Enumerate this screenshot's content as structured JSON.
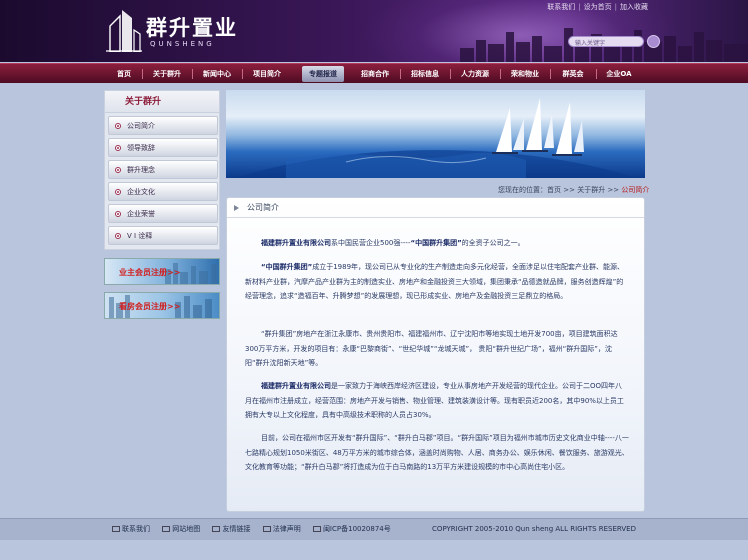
{
  "header": {
    "logo_cn": "群升置业",
    "logo_en": "QUNSHENG",
    "top_links": [
      "联系我们",
      "设为首页",
      "加入收藏"
    ],
    "search_placeholder": "输入关键字"
  },
  "nav": [
    "首页",
    "关于群升",
    "新闻中心",
    "项目简介",
    "专题报道",
    "招商合作",
    "招标信息",
    "人力资源",
    "荣和物业",
    "群英会",
    "企业OA"
  ],
  "sidebar": {
    "title": "关于群升",
    "items": [
      "公司简介",
      "领导致辞",
      "群升理念",
      "企业文化",
      "企业荣誉",
      "V I 诠释"
    ],
    "banners": [
      "业主会员注册>>",
      "看房会员注册>>"
    ]
  },
  "breadcrumb": {
    "prefix": "您现在的位置：",
    "home": "首页",
    "sep": ">>",
    "parent": "关于群升",
    "current": "公司简介"
  },
  "content": {
    "title": "公司简介",
    "p1_a": "福建群升置业有限公司",
    "p1_b": "系中国民营企业500强----",
    "p1_c": "“中国群升集团”",
    "p1_d": "的全资子公司之一。",
    "p2_a": "“中国群升集团”",
    "p2_b": "成立于1989年，现公司已从专业化的生产制造走向多元化经营，全面涉足以住宅配套产业群、能源、新材料产业群，汽摩产品产业群为主的制造实业、房地产和金融投资三大领域，集团秉承“品德造就品牌，服务创造辉煌”的经营理念，追求“造福百年、升腾梦想”的发展理想，现已形成实业、房地产及金融投资三足鼎立的格局。",
    "p3": "“群升集团”房地产在浙江永康市、贵州贵阳市、福建福州市、辽宁沈阳市等地实现土地开发700亩，项目建筑面积达300万平方米，开发的项目有：永康“巴黎商街”、“世纪华城”“龙城天城”，  贵阳“群升世纪广场”，福州“群升国际”，沈阳“群升沈阳新天地”等。",
    "p4_a": "福建群升置业有限公司",
    "p4_b": "是一家致力于海峡西岸经济区建设，专业从事房地产开发经营的现代企业。公司于二OO四年八月在福州市注册成立，经营范围：房地产开发与销售、物业管理、建筑装潢设计等。现有职员近200名，其中90%以上员工拥有大专以上文化程度，具有中高级技术职称的人员占30%。",
    "p5": "目前，公司在福州市区开发有“群升国际”、“群升白马郡”项目。“群升国际”项目为福州市城市历史文化商业中轴----八一七路精心规划1050米街区、48万平方米的城市综合体，涵盖时尚购物、人居、商务办公、娱乐休闲、餐饮服务、旅游观光、文化教育等功能；“群升白马郡”将打造成为位于白马南路的13万平方米建设规模的市中心高尚住宅小区。"
  },
  "footer": {
    "links": [
      "联系我们",
      "网站地图",
      "友情链接",
      "法律声明",
      "闽ICP备10020874号"
    ],
    "copyright": "COPYRIGHT 2005-2010 Qun sheng ALL RIGHTS RESERVED"
  },
  "colors": {
    "header_purple": "#3a1757",
    "nav_maroon": "#8b1e3e",
    "page_bg": "#b9c5dc",
    "accent_red": "#b81c1c"
  }
}
